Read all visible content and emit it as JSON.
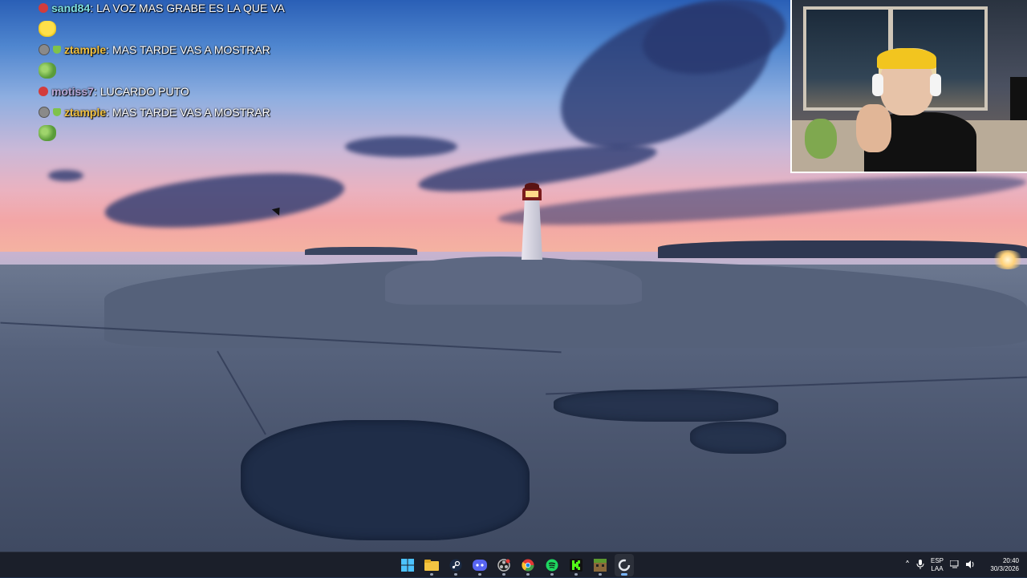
{
  "chat": {
    "messages": [
      {
        "user": "sand84",
        "text": "LA VOZ MAS GRABE ES LA QUE VA",
        "user_color": "#7fe0e0",
        "badges": [
          "red"
        ],
        "emote": "smile"
      },
      {
        "user": "ztample",
        "text": "MAS TARDE VAS A MOSTRAR",
        "user_color": "#f0c040",
        "badges": [
          "grey",
          "green"
        ],
        "emote": "pepe"
      },
      {
        "user": "motiss7",
        "text": "LUCARDO PUTO",
        "user_color": "#b9a8d8",
        "badges": [
          "red"
        ],
        "emote": null
      },
      {
        "user": "ztample",
        "text": "MAS TARDE VAS A MOSTRAR",
        "user_color": "#f0c040",
        "badges": [
          "grey",
          "green"
        ],
        "emote": "pepe"
      }
    ]
  },
  "taskbar": {
    "apps": [
      {
        "icon": "windows-start-icon",
        "label": "Start"
      },
      {
        "icon": "file-explorer-icon",
        "label": "File Explorer"
      },
      {
        "icon": "steam-icon",
        "label": "Steam"
      },
      {
        "icon": "discord-icon",
        "label": "Discord"
      },
      {
        "icon": "obs-icon",
        "label": "OBS"
      },
      {
        "icon": "chrome-icon",
        "label": "Chrome"
      },
      {
        "icon": "spotify-icon",
        "label": "Spotify"
      },
      {
        "icon": "kick-icon",
        "label": "Kick"
      },
      {
        "icon": "minecraft-icon",
        "label": "Minecraft"
      },
      {
        "icon": "app-c-icon",
        "label": "App"
      }
    ],
    "tray": {
      "language_line1": "ESP",
      "language_line2": "LAA",
      "time": "20:40",
      "date": "30/3/2026"
    }
  },
  "colors": {
    "taskbar_bg": "#1b1f2a",
    "accent": "#7ab6ff"
  }
}
